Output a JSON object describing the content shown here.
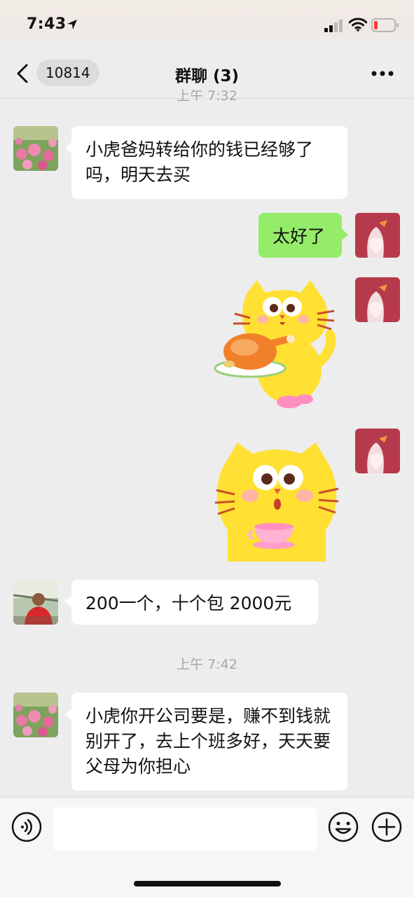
{
  "status_bar": {
    "time": "7:43"
  },
  "header": {
    "back_label": "<",
    "unread_count": "10814",
    "title": "群聊 (3)",
    "more_label": "···"
  },
  "chat": {
    "partial_timestamp": "上午 7:32",
    "messages": [
      {
        "side": "left",
        "type": "text",
        "text": "小虎爸妈转给你的钱已经够了吗，明天去买"
      },
      {
        "side": "right",
        "type": "text",
        "text": "太好了"
      },
      {
        "side": "right",
        "type": "sticker",
        "sticker": "yellow-cat-holding-roast-chicken"
      },
      {
        "side": "right",
        "type": "sticker",
        "sticker": "yellow-cat-holding-teacup"
      },
      {
        "side": "left",
        "type": "text",
        "text": "200一个，十个包 2000元"
      },
      {
        "side": "left",
        "type": "text",
        "text": "小虎你开公司要是，赚不到钱就别开了，去上个班多好，天天要父母为你担心"
      }
    ],
    "timestamp_2": "上午 7:42"
  },
  "input_bar": {
    "placeholder": ""
  },
  "colors": {
    "background": "#ededed",
    "sent_bubble": "#95ec69",
    "received_bubble": "#ffffff",
    "timestamp": "#a6a6a6"
  },
  "icons": [
    "location-arrow-icon",
    "signal-icon",
    "wifi-icon",
    "battery-icon",
    "back-icon",
    "more-icon",
    "voice-icon",
    "emoji-icon",
    "plus-icon"
  ]
}
